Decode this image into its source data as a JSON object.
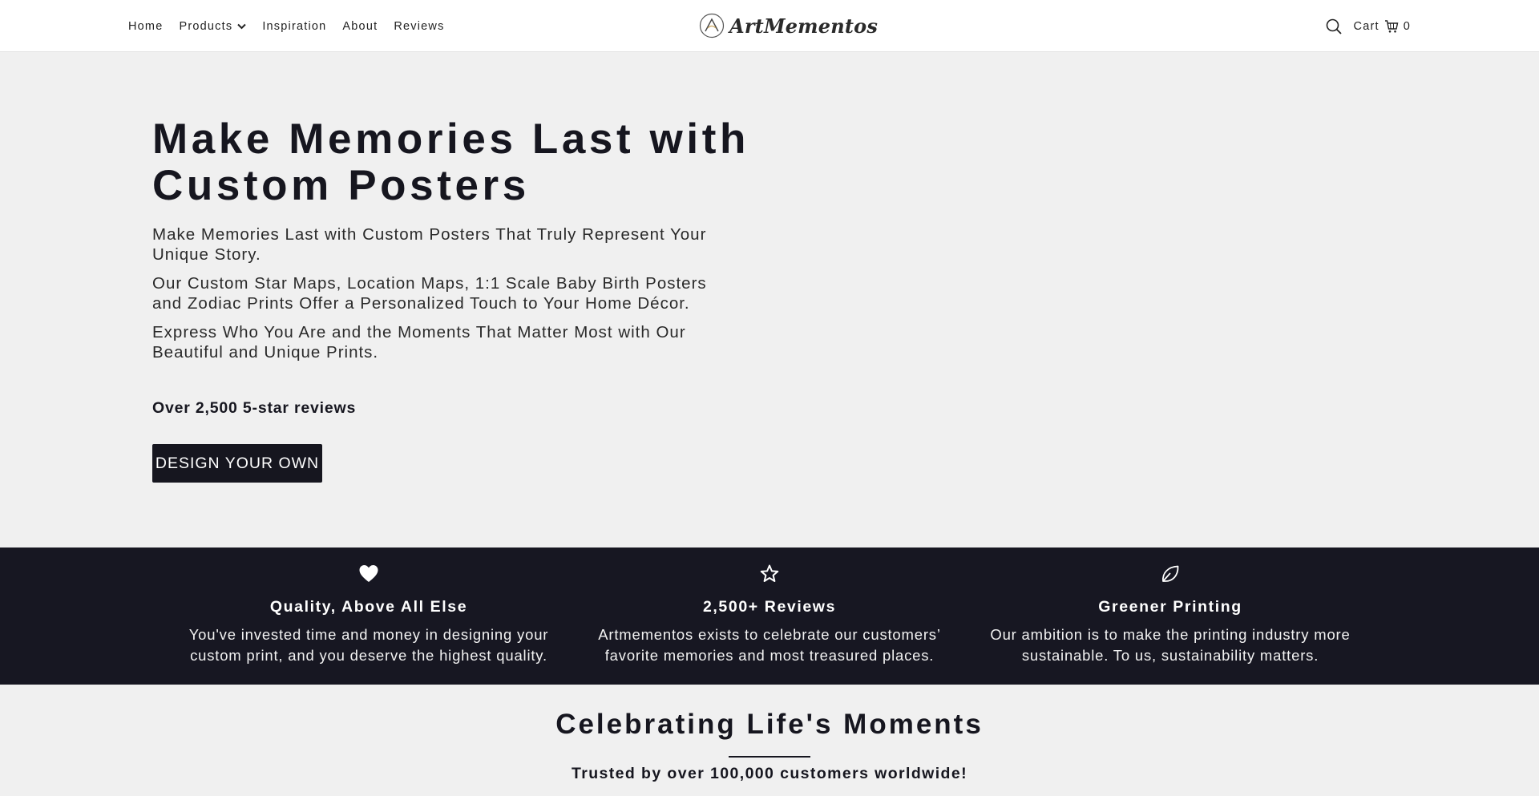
{
  "header": {
    "nav": [
      {
        "label": "Home"
      },
      {
        "label": "Products",
        "has_dropdown": true
      },
      {
        "label": "Inspiration"
      },
      {
        "label": "About"
      },
      {
        "label": "Reviews"
      }
    ],
    "logo_text": "ArtMementos",
    "cart_label": "Cart",
    "cart_count": "0"
  },
  "hero": {
    "title": "Make Memories Last with Custom Posters",
    "paragraphs": [
      "Make Memories Last with Custom Posters That Truly Represent Your Unique Story.",
      "Our Custom Star Maps, Location Maps, 1:1 Scale Baby Birth Posters and Zodiac Prints Offer a Personalized Touch to Your Home Décor.",
      "Express Who You Are and the Moments That Matter Most with Our Beautiful and Unique Prints."
    ],
    "reviews_text": "Over 2,500 5-star reviews",
    "cta_label": "DESIGN YOUR OWN"
  },
  "features": [
    {
      "icon": "heart-icon",
      "title": "Quality, Above All Else",
      "description": "You've invested time and money in designing your custom print, and you deserve the highest quality."
    },
    {
      "icon": "star-icon",
      "title": "2,500+ Reviews",
      "description": "Artmementos exists to celebrate our customers’ favorite memories and most treasured places."
    },
    {
      "icon": "leaf-icon",
      "title": "Greener Printing",
      "description": "Our ambition is to make the printing industry more sustainable. To us, sustainability matters."
    }
  ],
  "celebrate": {
    "title": "Celebrating Life's Moments",
    "subtitle": "Trusted by over 100,000 customers worldwide!"
  },
  "colors": {
    "dark": "#16161f",
    "band": "#171722",
    "page_bg": "#f0f0f0",
    "header_bg": "#ffffff"
  }
}
